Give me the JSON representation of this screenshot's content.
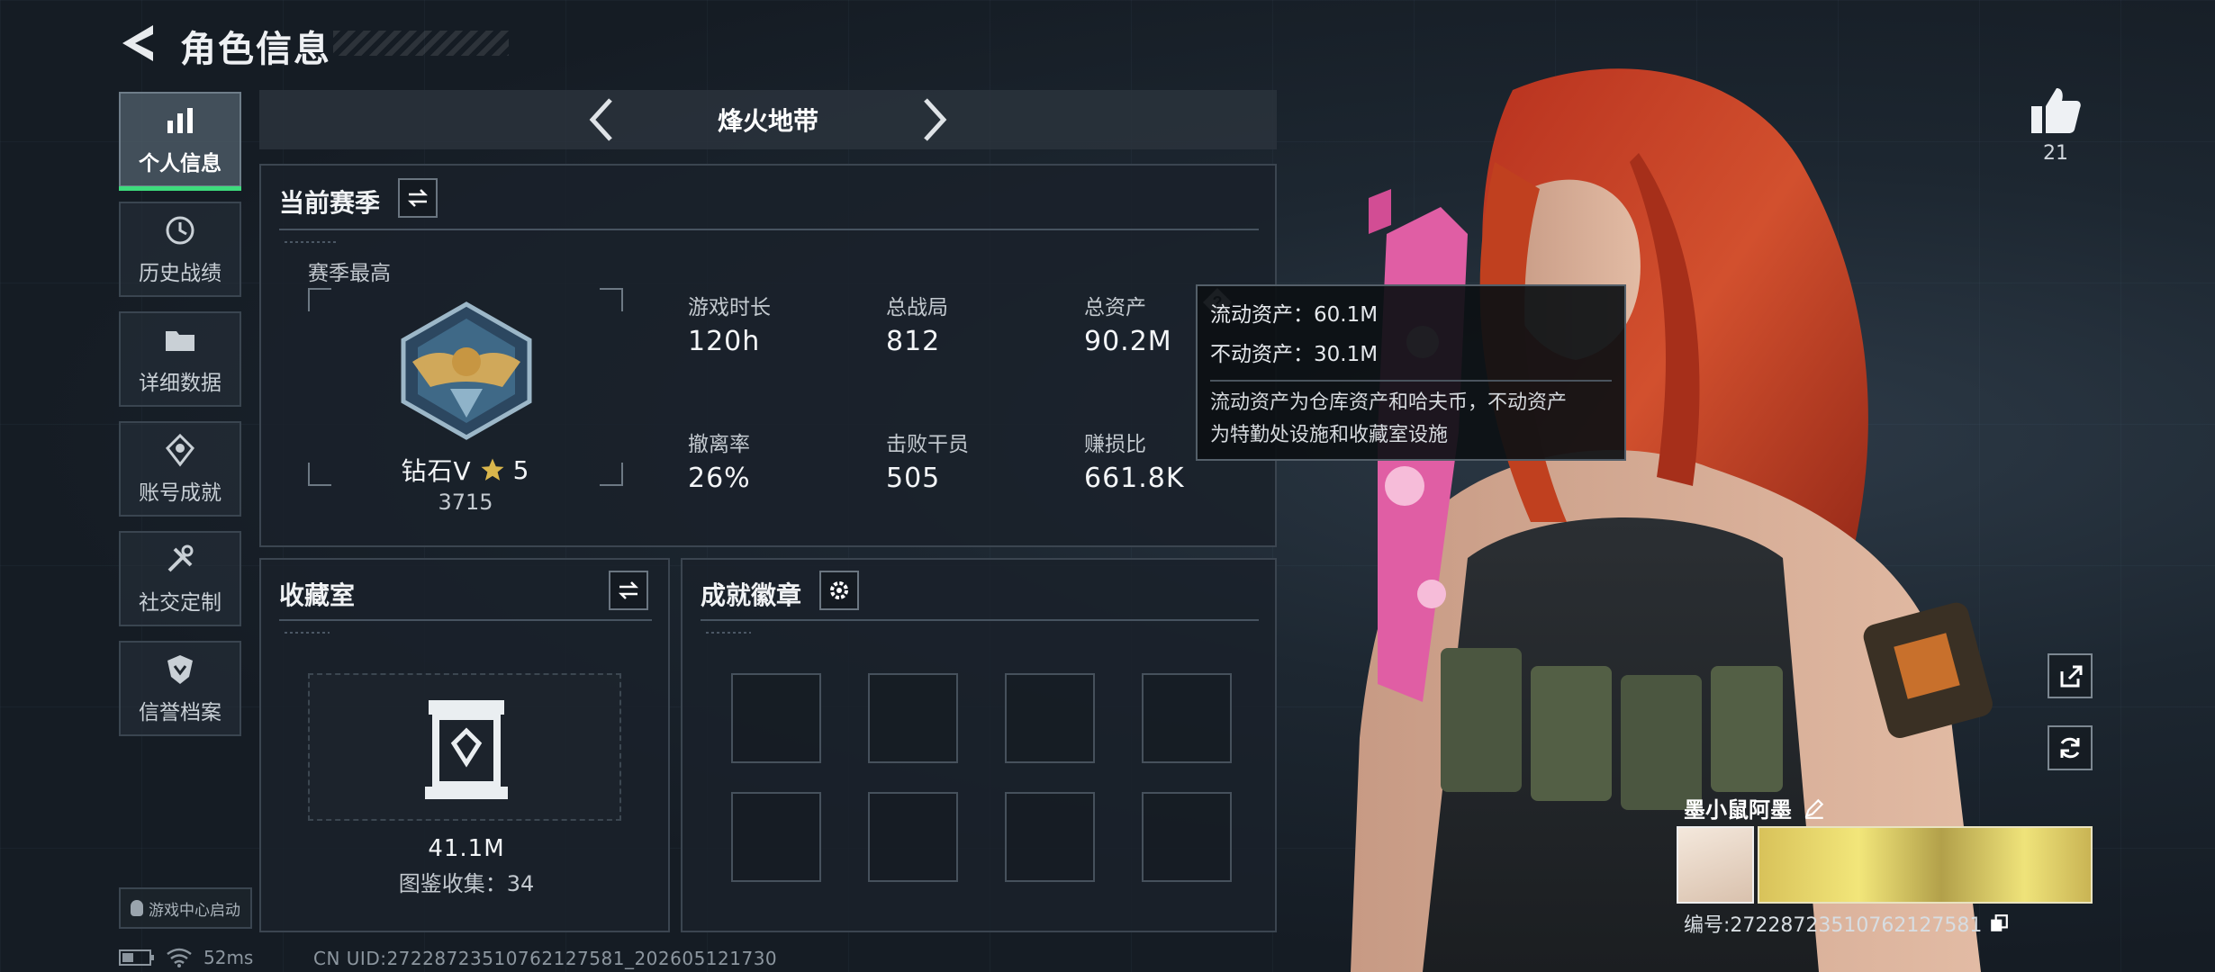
{
  "header": {
    "title": "角色信息",
    "back_icon": "back-arrow-icon"
  },
  "sidebar": {
    "items": [
      {
        "label": "个人信息",
        "icon": "bar-chart-icon",
        "active": true
      },
      {
        "label": "历史战绩",
        "icon": "history-icon",
        "active": false
      },
      {
        "label": "详细数据",
        "icon": "folder-icon",
        "active": false
      },
      {
        "label": "账号成就",
        "icon": "achievement-icon",
        "active": false
      },
      {
        "label": "社交定制",
        "icon": "tools-icon",
        "active": false
      },
      {
        "label": "信誉档案",
        "icon": "credit-shield-icon",
        "active": false
      }
    ],
    "launcher_label": "游戏中心启动"
  },
  "mode": {
    "label": "烽火地带"
  },
  "season": {
    "title": "当前赛季",
    "subtitle": "赛季最高",
    "rank_name": "钻石V",
    "rank_stars": "5",
    "rank_score": "3715",
    "stats": [
      {
        "label": "游戏时长",
        "value": "120h"
      },
      {
        "label": "总战局",
        "value": "812"
      },
      {
        "label": "总资产",
        "value": "90.2M"
      },
      {
        "label": "撤离率",
        "value": "26%"
      },
      {
        "label": "击败干员",
        "value": "505"
      },
      {
        "label": "赚损比",
        "value": "661.8K"
      }
    ]
  },
  "tooltip": {
    "liquid": "流动资产：60.1M",
    "fixed": "不动资产：30.1M",
    "desc_line1": "流动资产为仓库资产和哈夫币，不动资产",
    "desc_line2": "为特勤处设施和收藏室设施"
  },
  "collection": {
    "title": "收藏室",
    "value": "41.1M",
    "count": "图鉴收集：34"
  },
  "badges": {
    "title": "成就徽章",
    "slots": 8
  },
  "like": {
    "count": "21"
  },
  "player": {
    "name": "墨小鼠阿墨",
    "uid_label": "编号:2722872351076212758​1"
  },
  "status": {
    "ping": "52ms",
    "cn_uid": "CN UID:2722872351076212758​1_202605121730"
  },
  "colors": {
    "accent_green": "#3ddc7c",
    "bg": "#161d25"
  }
}
